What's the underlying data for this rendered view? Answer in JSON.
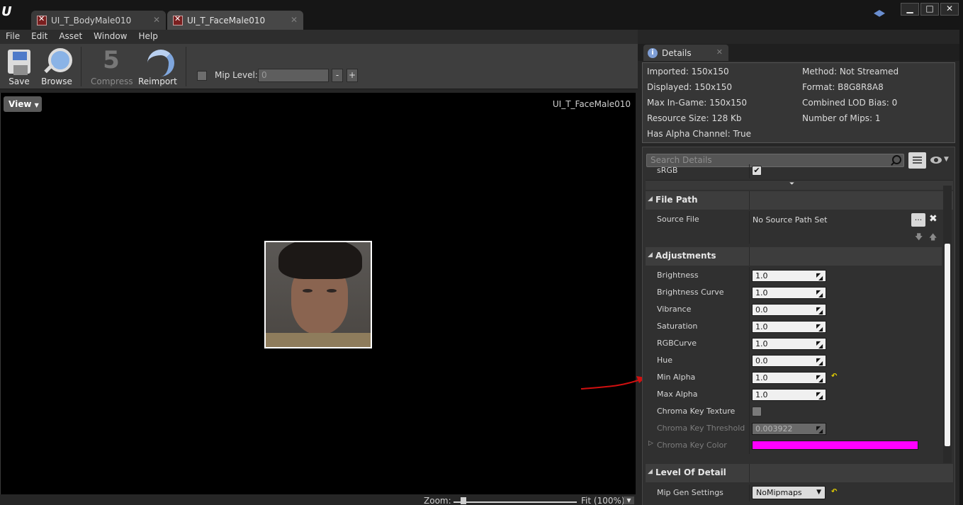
{
  "tabs": [
    {
      "label": "UI_T_BodyMale010",
      "active": false
    },
    {
      "label": "UI_T_FaceMale010",
      "active": true
    }
  ],
  "window_controls": {
    "minimize": "▁",
    "maximize": "□",
    "close": "✕"
  },
  "menu": [
    "File",
    "Edit",
    "Asset",
    "Window",
    "Help"
  ],
  "toolbar": {
    "save_label": "Save",
    "browse_label": "Browse",
    "compress_label": "Compress",
    "reimport_label": "Reimport",
    "mip_level_label": "Mip Level:",
    "mip_level_value": "0",
    "minus": "-",
    "plus": "+"
  },
  "viewport": {
    "view_button": "View",
    "asset_name": "UI_T_FaceMale010",
    "zoom_label": "Zoom:",
    "zoom_value": "Fit (100%)",
    "zoom_fraction": 0.08
  },
  "details": {
    "tab_label": "Details",
    "info_left": [
      "Imported: 150x150",
      "Displayed: 150x150",
      "Max In-Game: 150x150",
      "Resource Size: 128 Kb",
      "Has Alpha Channel: True"
    ],
    "info_right": [
      "Method: Not Streamed",
      "Format: B8G8R8A8",
      "Combined LOD Bias: 0",
      "Number of Mips: 1"
    ],
    "search_placeholder": "Search Details",
    "srgb_label": "sRGB",
    "file_path": {
      "category": "File Path",
      "source_file_label": "Source File",
      "source_file_value": "No Source Path Set",
      "browse_button": "..."
    },
    "adjustments": {
      "category": "Adjustments",
      "fields": [
        {
          "label": "Brightness",
          "value": "1.0"
        },
        {
          "label": "Brightness Curve",
          "value": "1.0"
        },
        {
          "label": "Vibrance",
          "value": "0.0"
        },
        {
          "label": "Saturation",
          "value": "1.0"
        },
        {
          "label": "RGBCurve",
          "value": "1.0"
        },
        {
          "label": "Hue",
          "value": "0.0"
        },
        {
          "label": "Min Alpha",
          "value": "1.0"
        },
        {
          "label": "Max Alpha",
          "value": "1.0"
        }
      ],
      "chroma_key_texture_label": "Chroma Key Texture",
      "chroma_key_threshold_label": "Chroma Key Threshold",
      "chroma_key_threshold_value": "0.003922",
      "chroma_key_color_label": "Chroma Key Color",
      "chroma_key_color": "#ff00ff"
    },
    "level_of_detail": {
      "category": "Level Of Detail",
      "mip_gen_label": "Mip Gen Settings",
      "mip_gen_value": "NoMipmaps"
    }
  },
  "colors": {
    "accent": "#4e7ac9",
    "reset_arrow": "#e7d300",
    "annotation_arrow": "#d01010"
  }
}
